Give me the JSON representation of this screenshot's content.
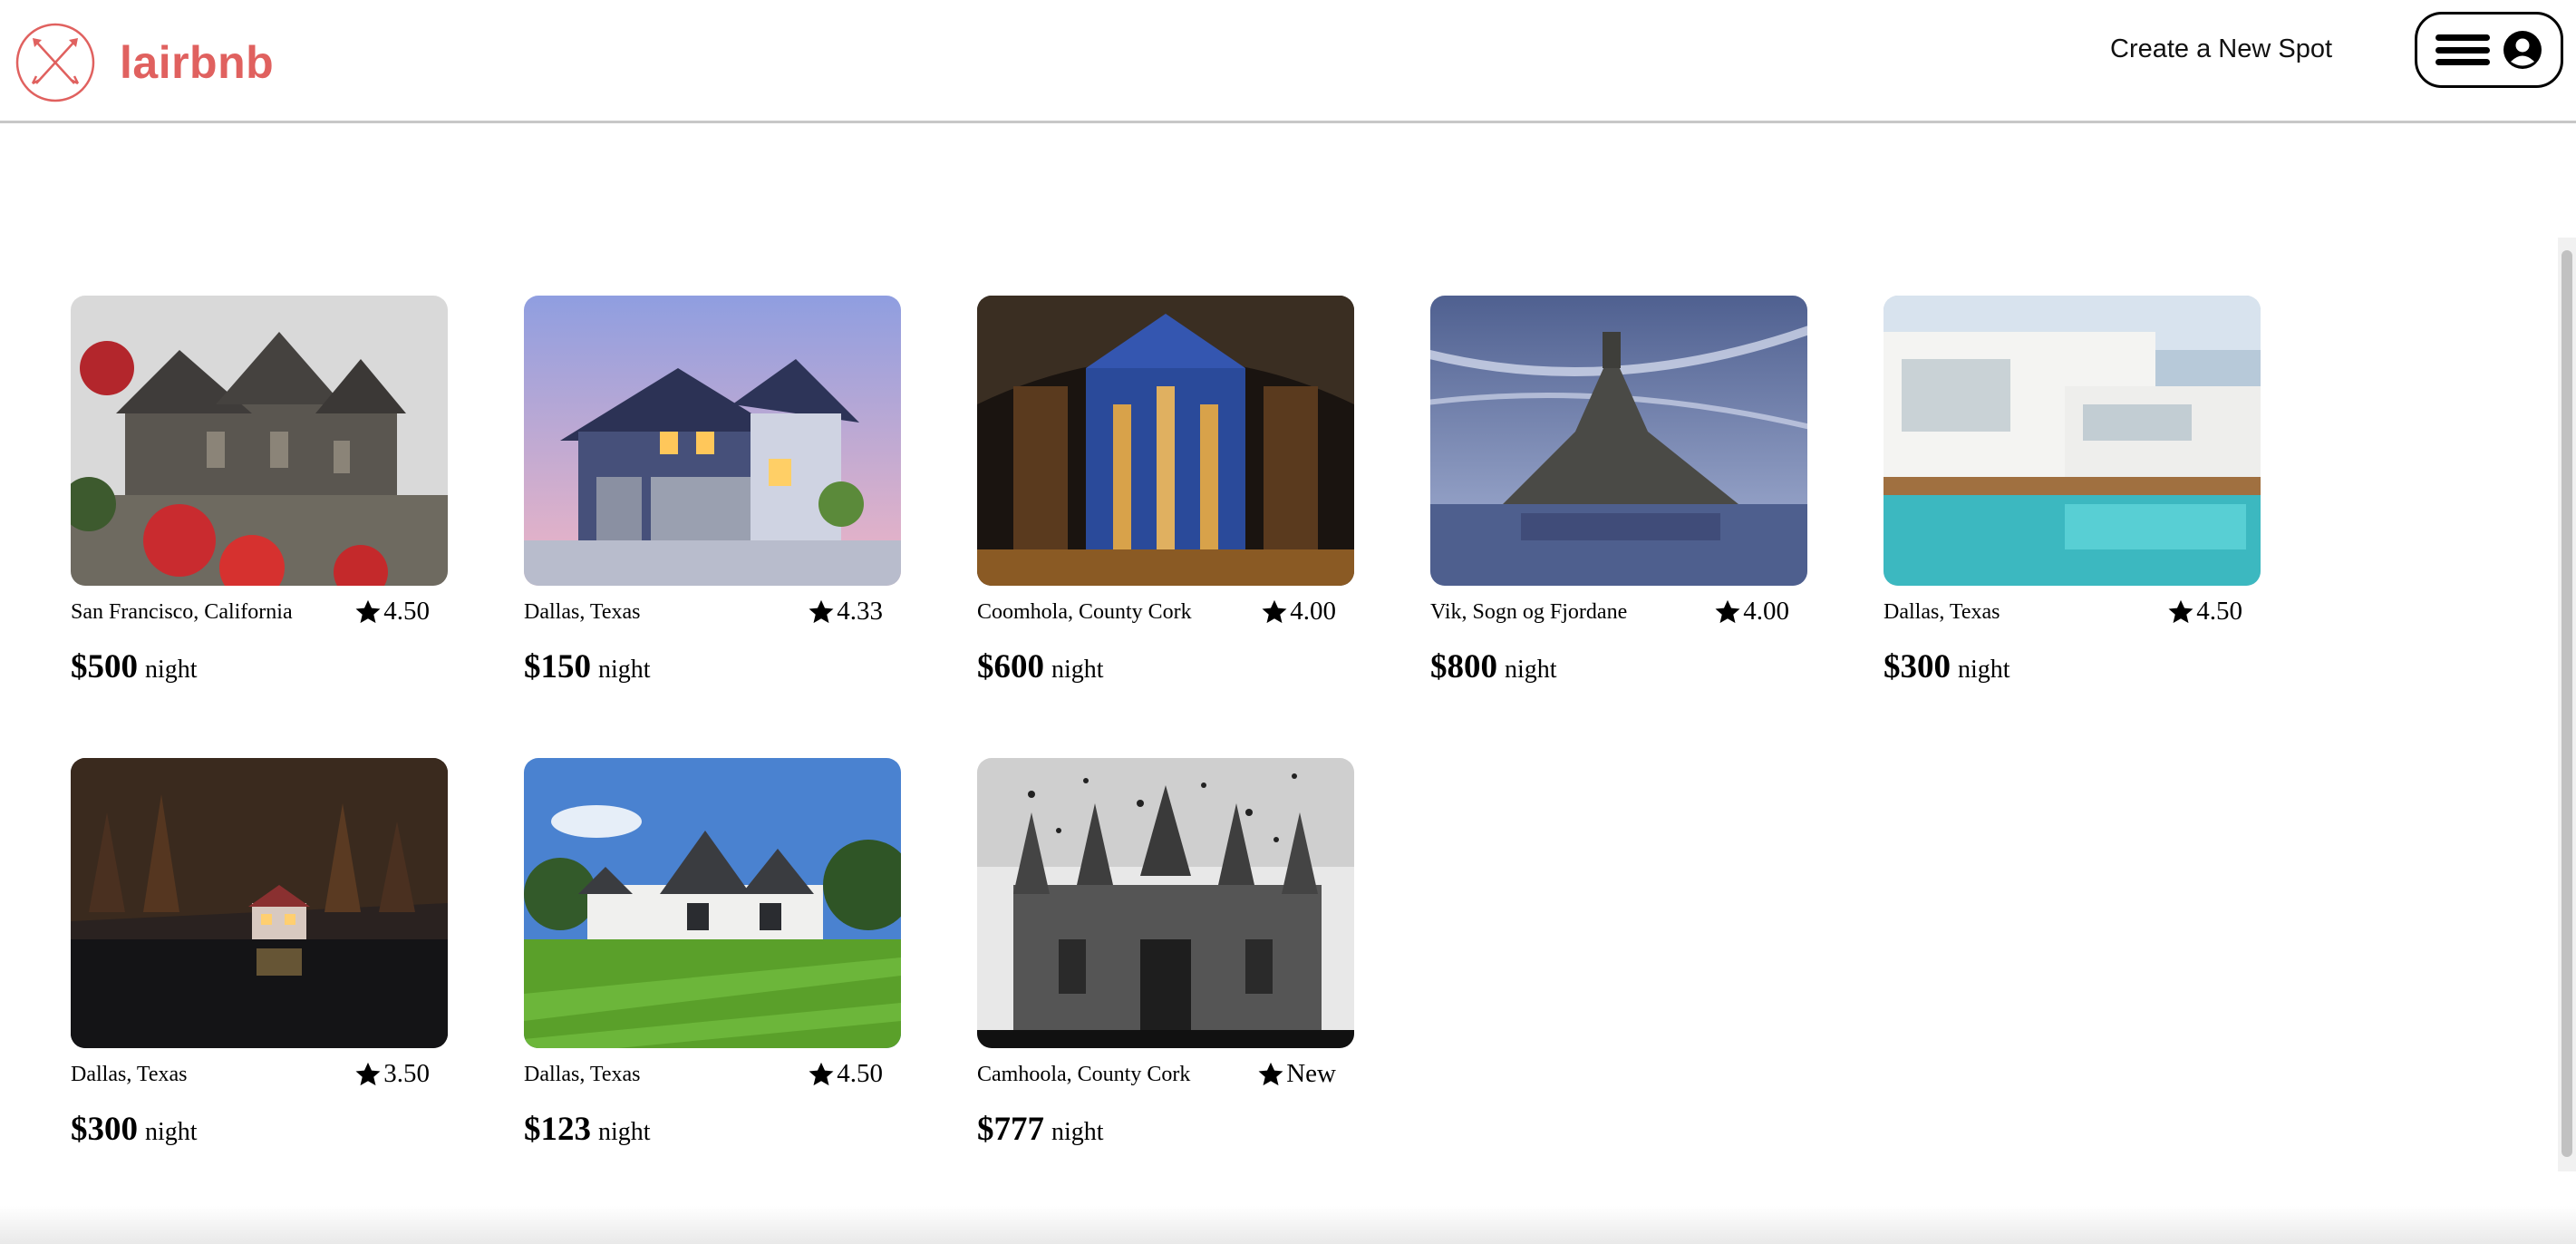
{
  "header": {
    "brand": "lairbnb",
    "create_spot_label": "Create a New Spot",
    "brand_color": "#e0615f"
  },
  "spots": [
    {
      "location": "San Francisco, California",
      "rating": "4.50",
      "price": "$500",
      "price_unit": "night"
    },
    {
      "location": "Dallas, Texas",
      "rating": "4.33",
      "price": "$150",
      "price_unit": "night"
    },
    {
      "location": "Coomhola, County Cork",
      "rating": "4.00",
      "price": "$600",
      "price_unit": "night"
    },
    {
      "location": "Vik, Sogn og Fjordane",
      "rating": "4.00",
      "price": "$800",
      "price_unit": "night"
    },
    {
      "location": "Dallas, Texas",
      "rating": "4.50",
      "price": "$300",
      "price_unit": "night"
    },
    {
      "location": "Dallas, Texas",
      "rating": "3.50",
      "price": "$300",
      "price_unit": "night"
    },
    {
      "location": "Dallas, Texas",
      "rating": "4.50",
      "price": "$123",
      "price_unit": "night"
    },
    {
      "location": "Camhoola, County Cork",
      "rating": "New",
      "price": "$777",
      "price_unit": "night"
    }
  ]
}
